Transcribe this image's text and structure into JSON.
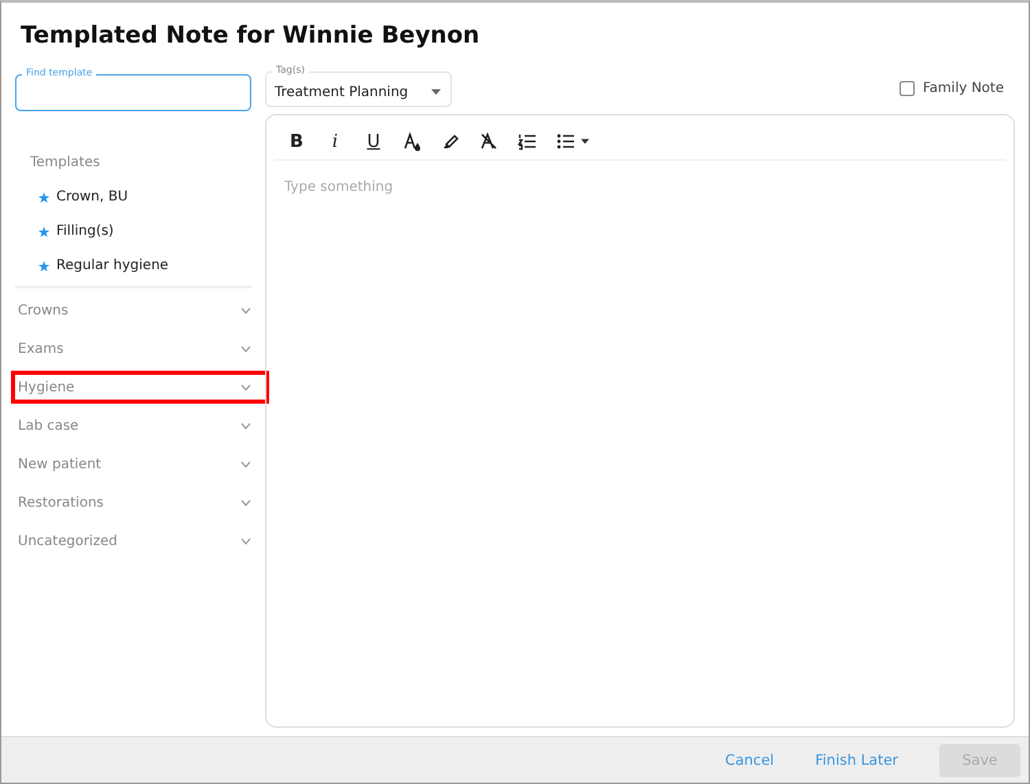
{
  "dialog": {
    "title": "Templated Note for Winnie Beynon"
  },
  "search": {
    "label": "Find template",
    "focused": true
  },
  "tags": {
    "label": "Tag(s)",
    "value": "Treatment Planning"
  },
  "family_note": {
    "label": "Family Note",
    "checked": false
  },
  "toolbar": [
    {
      "kind": "bold",
      "label": "B"
    },
    {
      "kind": "italic",
      "label": "i"
    },
    {
      "kind": "underline",
      "label": "U"
    },
    {
      "kind": "font-color"
    },
    {
      "kind": "highlight"
    },
    {
      "kind": "clear-format"
    },
    {
      "kind": "ordered-list"
    },
    {
      "kind": "bullet-list"
    }
  ],
  "editor": {
    "placeholder": "Type something"
  },
  "templates": {
    "heading": "Templates",
    "items": [
      "Crown, BU",
      "Filling(s)",
      "Regular hygiene"
    ]
  },
  "categories": [
    {
      "label": "Crowns",
      "highlighted": false,
      "expanded": false
    },
    {
      "label": "Exams",
      "highlighted": false,
      "expanded": false
    },
    {
      "label": "Hygiene",
      "highlighted": true,
      "expanded": false
    },
    {
      "label": "Lab case",
      "highlighted": false,
      "expanded": false
    },
    {
      "label": "New patient",
      "highlighted": false,
      "expanded": false
    },
    {
      "label": "Restorations",
      "highlighted": false,
      "expanded": false
    },
    {
      "label": "Uncategorized",
      "highlighted": false,
      "expanded": false
    }
  ],
  "footer": {
    "buttons": [
      {
        "label": "Cancel",
        "kind": "link",
        "disabled": false
      },
      {
        "label": "Finish Later",
        "kind": "link",
        "disabled": false
      },
      {
        "label": "Save",
        "kind": "primary",
        "disabled": true
      }
    ]
  }
}
